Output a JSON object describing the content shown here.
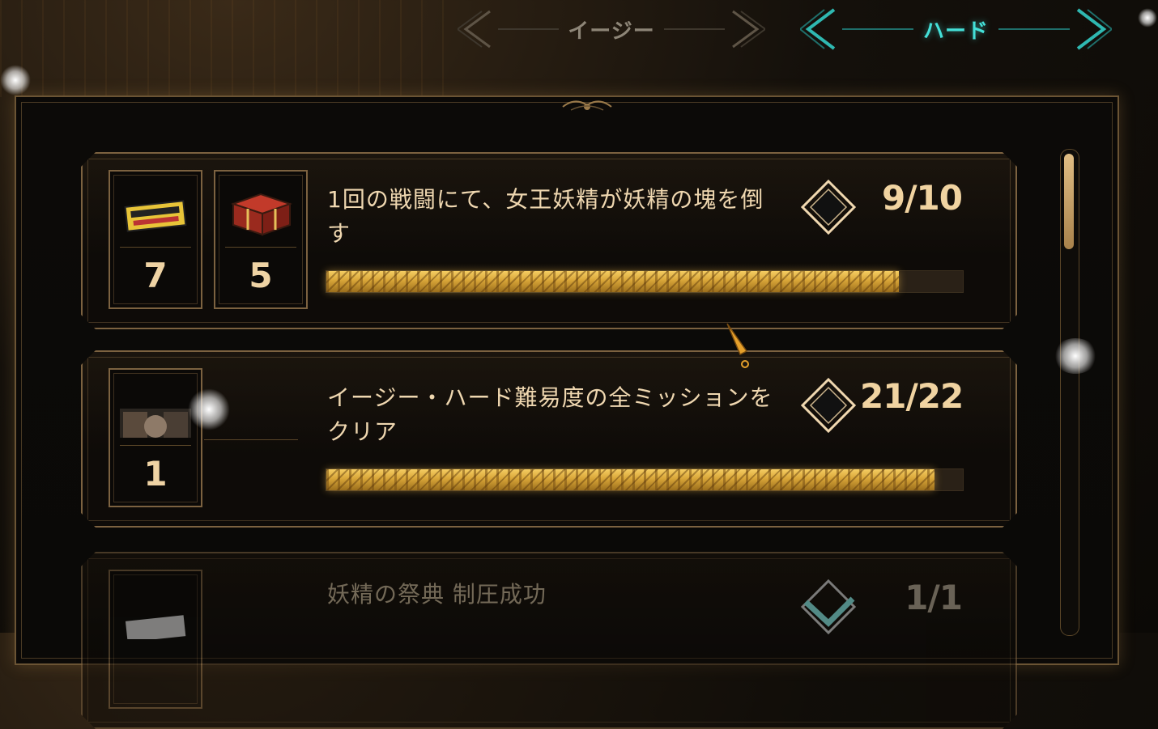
{
  "tabs": {
    "easy": {
      "label": "イージー",
      "selected": false
    },
    "hard": {
      "label": "ハード",
      "selected": true
    }
  },
  "missions": [
    {
      "title": "1回の戦闘にて、女王妖精が妖精の塊を倒す",
      "progress_text": "9/10",
      "progress": 0.9,
      "completed": false,
      "rewards": [
        {
          "icon": "ticket-icon",
          "quantity": "7"
        },
        {
          "icon": "treasure-chest-icon",
          "quantity": "5"
        }
      ]
    },
    {
      "title": "イージー・ハード難易度の全ミッションをクリア",
      "progress_text": "21/22",
      "progress": 0.955,
      "completed": false,
      "rewards": [
        {
          "icon": "portrait-card-icon",
          "quantity": "1"
        }
      ]
    },
    {
      "title": "妖精の祭典 制圧成功",
      "progress_text": "1/1",
      "progress": 1.0,
      "completed": true,
      "rewards": [
        {
          "icon": "card-icon",
          "quantity": ""
        }
      ]
    }
  ],
  "colors": {
    "accent_gold": "#efd3a4",
    "tab_active": "#44e0d8",
    "tab_inactive": "#8d8577",
    "bar_fill": "#e0b24a"
  }
}
